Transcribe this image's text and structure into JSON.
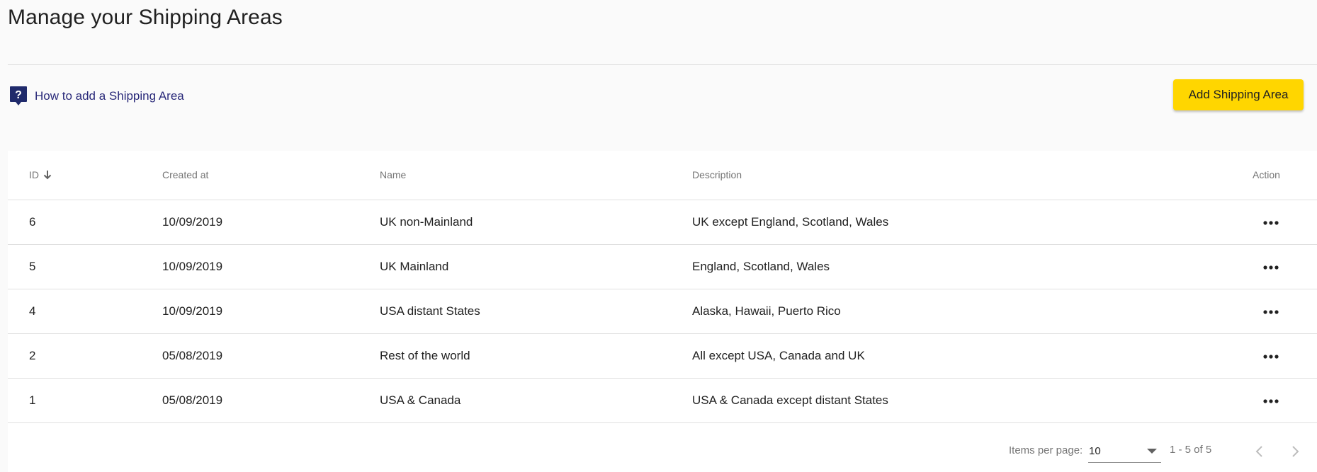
{
  "page": {
    "title": "Manage your Shipping Areas"
  },
  "help": {
    "link_text": "How to add a Shipping Area",
    "icon": "question-mark-icon"
  },
  "toolbar": {
    "add_label": "Add Shipping Area"
  },
  "colors": {
    "accent": "#ffd600",
    "link": "#2a2a7a",
    "help_icon_bg": "#1f2a6b"
  },
  "table": {
    "columns": {
      "id": "ID",
      "created_at": "Created at",
      "name": "Name",
      "description": "Description",
      "action": "Action"
    },
    "sort": {
      "column": "ID",
      "direction": "descending",
      "icon": "arrow-down-icon"
    },
    "rows": [
      {
        "id": "6",
        "created_at": "10/09/2019",
        "name": "UK non-Mainland",
        "description": "UK except England, Scotland, Wales"
      },
      {
        "id": "5",
        "created_at": "10/09/2019",
        "name": "UK Mainland",
        "description": "England, Scotland, Wales"
      },
      {
        "id": "4",
        "created_at": "10/09/2019",
        "name": "USA distant States",
        "description": "Alaska, Hawaii, Puerto Rico"
      },
      {
        "id": "2",
        "created_at": "05/08/2019",
        "name": "Rest of the world",
        "description": "All except USA, Canada and UK"
      },
      {
        "id": "1",
        "created_at": "05/08/2019",
        "name": "USA & Canada",
        "description": "USA & Canada except distant States"
      }
    ]
  },
  "paginator": {
    "items_per_page_label": "Items per page:",
    "items_per_page_value": "10",
    "range_label": "1 - 5 of 5"
  }
}
